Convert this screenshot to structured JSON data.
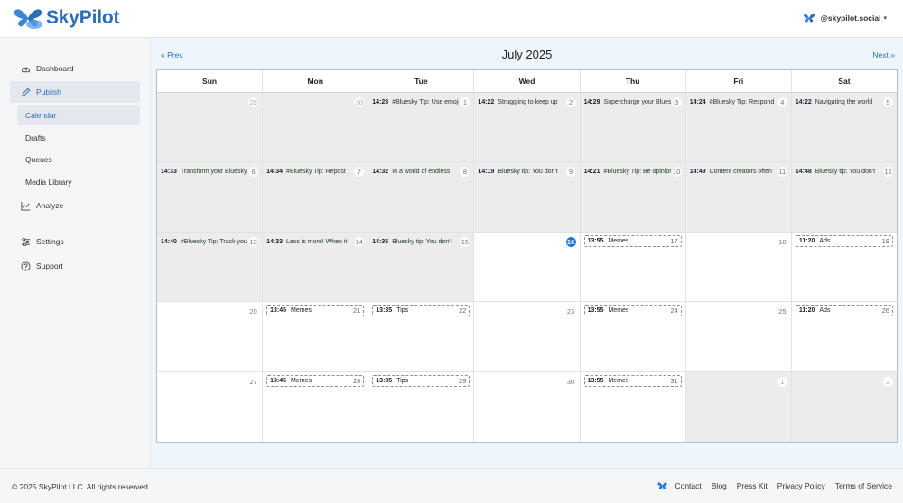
{
  "brand": {
    "name": "SkyPilot"
  },
  "account": {
    "handle": "@skypilot.social"
  },
  "sidebar": {
    "items": [
      {
        "label": "Dashboard"
      },
      {
        "label": "Publish"
      },
      {
        "label": "Analyze"
      },
      {
        "label": "Settings"
      },
      {
        "label": "Support"
      }
    ],
    "sub_items": [
      {
        "label": "Calendar"
      },
      {
        "label": "Drafts"
      },
      {
        "label": "Queues"
      },
      {
        "label": "Media Library"
      }
    ]
  },
  "calendar": {
    "prev_label": "« Prev",
    "next_label": "Next »",
    "title": "July 2025",
    "days_of_week": [
      "Sun",
      "Mon",
      "Tue",
      "Wed",
      "Thu",
      "Fri",
      "Sat"
    ],
    "weeks": [
      [
        {
          "num": "29",
          "kind": "other"
        },
        {
          "num": "30",
          "kind": "other"
        },
        {
          "num": "1",
          "kind": "past",
          "event": {
            "time": "14:28",
            "text": "#Bluesky Tip: Use emojis"
          }
        },
        {
          "num": "2",
          "kind": "past",
          "event": {
            "time": "14:22",
            "text": "Struggling to keep up"
          }
        },
        {
          "num": "3",
          "kind": "past",
          "event": {
            "time": "14:29",
            "text": "Supercharge your Bluesky"
          }
        },
        {
          "num": "4",
          "kind": "past",
          "event": {
            "time": "14:24",
            "text": "#Bluesky Tip: Respond"
          }
        },
        {
          "num": "5",
          "kind": "past",
          "event": {
            "time": "14:22",
            "text": "Navigating the world"
          }
        }
      ],
      [
        {
          "num": "6",
          "kind": "past",
          "event": {
            "time": "14:33",
            "text": "Transform your Bluesky"
          }
        },
        {
          "num": "7",
          "kind": "past",
          "event": {
            "time": "14:34",
            "text": "#Bluesky Tip: Repost"
          }
        },
        {
          "num": "8",
          "kind": "past",
          "event": {
            "time": "14:32",
            "text": "In a world of endless"
          }
        },
        {
          "num": "9",
          "kind": "past",
          "event": {
            "time": "14:19",
            "text": "Bluesky tip: You don't"
          }
        },
        {
          "num": "10",
          "kind": "past",
          "event": {
            "time": "14:21",
            "text": "#Bluesky Tip: Be opinionated"
          }
        },
        {
          "num": "11",
          "kind": "past",
          "event": {
            "time": "14:49",
            "text": "Content creators often"
          }
        },
        {
          "num": "12",
          "kind": "past",
          "event": {
            "time": "14:48",
            "text": "Bluesky tip: You don't"
          }
        }
      ],
      [
        {
          "num": "13",
          "kind": "past",
          "event": {
            "time": "14:40",
            "text": "#Bluesky Tip: Track your"
          }
        },
        {
          "num": "14",
          "kind": "past",
          "event": {
            "time": "14:33",
            "text": "Less is more! When it"
          }
        },
        {
          "num": "15",
          "kind": "past",
          "event": {
            "time": "14:35",
            "text": "Bluesky tip: You don't"
          }
        },
        {
          "num": "16",
          "kind": "today"
        },
        {
          "num": "17",
          "kind": "future",
          "slot": {
            "time": "13:55",
            "text": "Memes"
          }
        },
        {
          "num": "18",
          "kind": "future"
        },
        {
          "num": "19",
          "kind": "future",
          "slot": {
            "time": "11:20",
            "text": "Ads"
          }
        }
      ],
      [
        {
          "num": "20",
          "kind": "future"
        },
        {
          "num": "21",
          "kind": "future",
          "slot": {
            "time": "13:45",
            "text": "Memes"
          }
        },
        {
          "num": "22",
          "kind": "future",
          "slot": {
            "time": "13:35",
            "text": "Tips"
          }
        },
        {
          "num": "23",
          "kind": "future"
        },
        {
          "num": "24",
          "kind": "future",
          "slot": {
            "time": "13:55",
            "text": "Memes"
          }
        },
        {
          "num": "25",
          "kind": "future"
        },
        {
          "num": "26",
          "kind": "future",
          "slot": {
            "time": "11:20",
            "text": "Ads"
          }
        }
      ],
      [
        {
          "num": "27",
          "kind": "future"
        },
        {
          "num": "28",
          "kind": "future",
          "slot": {
            "time": "13:45",
            "text": "Memes"
          }
        },
        {
          "num": "29",
          "kind": "future",
          "slot": {
            "time": "13:35",
            "text": "Tips"
          }
        },
        {
          "num": "30",
          "kind": "future"
        },
        {
          "num": "31",
          "kind": "future",
          "slot": {
            "time": "13:55",
            "text": "Memes"
          }
        },
        {
          "num": "1",
          "kind": "other"
        },
        {
          "num": "2",
          "kind": "other"
        }
      ]
    ]
  },
  "footer": {
    "copyright": "© 2025 SkyPilot LLC. All rights reserved.",
    "links": [
      "Contact",
      "Blog",
      "Press Kit",
      "Privacy Policy",
      "Terms of Service"
    ]
  },
  "colors": {
    "brand": "#2a6fb8",
    "today": "#1e78d6"
  }
}
